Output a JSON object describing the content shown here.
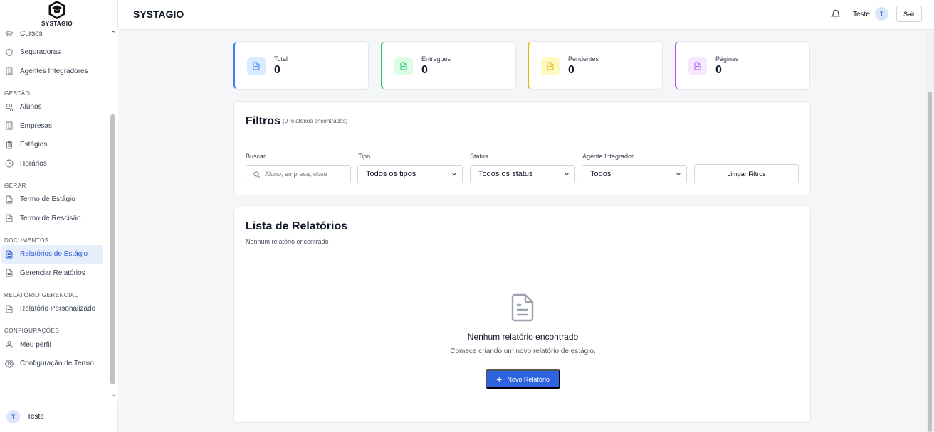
{
  "brand": {
    "logo_text": "SYSTAGIO"
  },
  "header": {
    "title": "SYSTAGIO",
    "user_name": "Teste",
    "avatar_initial": "T",
    "logout_label": "Sair"
  },
  "sidebar": {
    "groups": [
      {
        "label": "",
        "items": [
          {
            "label": "Cursos",
            "icon": "graduation-cap-icon"
          },
          {
            "label": "Seguradoras",
            "icon": "shield-icon"
          },
          {
            "label": "Agentes Integradores",
            "icon": "building-icon"
          }
        ]
      },
      {
        "label": "GESTÃO",
        "items": [
          {
            "label": "Alunos",
            "icon": "users-icon"
          },
          {
            "label": "Empresas",
            "icon": "building-icon"
          },
          {
            "label": "Estágios",
            "icon": "clipboard-icon"
          },
          {
            "label": "Horários",
            "icon": "clock-icon"
          }
        ]
      },
      {
        "label": "GERAR",
        "items": [
          {
            "label": "Termo de Estágio",
            "icon": "file-icon"
          },
          {
            "label": "Termo de Rescisão",
            "icon": "file-icon"
          }
        ]
      },
      {
        "label": "DOCUMENTOS",
        "items": [
          {
            "label": "Relatórios de Estágio",
            "icon": "file-text-icon",
            "active": true
          },
          {
            "label": "Gerenciar Relatórios",
            "icon": "file-icon"
          }
        ]
      },
      {
        "label": "RELATÓRIO GERENCIAL",
        "items": [
          {
            "label": "Relatório Personalizado",
            "icon": "file-icon"
          }
        ]
      },
      {
        "label": "CONFIGURAÇÕES",
        "items": [
          {
            "label": "Meu perfil",
            "icon": "user-icon"
          },
          {
            "label": "Configuração de Termo",
            "icon": "gear-icon"
          }
        ]
      }
    ],
    "footer": {
      "avatar_initial": "T",
      "user_name": "Teste"
    }
  },
  "stats": [
    {
      "label": "Total",
      "value": "0",
      "color": "#3b82f6",
      "bg": "#dbeafe"
    },
    {
      "label": "Entregues",
      "value": "0",
      "color": "#22c55e",
      "bg": "#dcfce7"
    },
    {
      "label": "Pendentes",
      "value": "0",
      "color": "#eab308",
      "bg": "#fef9c3"
    },
    {
      "label": "Páginas",
      "value": "0",
      "color": "#a855f7",
      "bg": "#f3e8ff"
    }
  ],
  "filters": {
    "title": "Filtros",
    "count": "(0 relatórios encontrados)",
    "search_label": "Buscar",
    "search_placeholder": "Aluno, empresa, obse",
    "type_label": "Tipo",
    "type_value": "Todos os tipos",
    "status_label": "Status",
    "status_value": "Todos os status",
    "agent_label": "Agente Integrador",
    "agent_value": "Todos",
    "clear_label": "Limpar Filtros"
  },
  "list": {
    "title": "Lista de Relatórios",
    "subtitle": "Nenhum relatório encontrado",
    "empty_title": "Nenhum relatório encontrado",
    "empty_text": "Comece criando um novo relatório de estágio.",
    "new_button": "Novo Relatório"
  }
}
